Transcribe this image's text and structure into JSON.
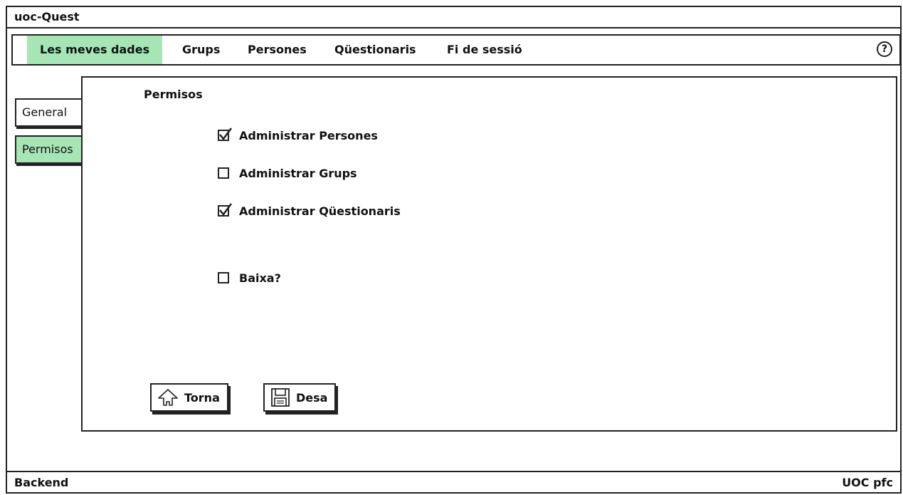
{
  "app": {
    "title": "uoc-Quest"
  },
  "menu": {
    "items": [
      {
        "label": "Les meves dades",
        "active": true
      },
      {
        "label": "Grups",
        "active": false
      },
      {
        "label": "Persones",
        "active": false
      },
      {
        "label": "Qüestionaris",
        "active": false
      },
      {
        "label": "Fi de sessió",
        "active": false
      }
    ],
    "help_symbol": "?"
  },
  "side_tabs": [
    {
      "label": "General",
      "active": false
    },
    {
      "label": "Permisos",
      "active": true
    }
  ],
  "panel": {
    "title": "Permisos",
    "checkboxes": [
      {
        "label": "Administrar Persones",
        "checked": true
      },
      {
        "label": "Administrar Grups",
        "checked": false
      },
      {
        "label": "Administrar Qüestionaris",
        "checked": true
      },
      {
        "label": "Baixa?",
        "checked": false
      }
    ],
    "buttons": {
      "back_label": "Torna",
      "save_label": "Desa"
    }
  },
  "footer": {
    "left": "Backend",
    "right": "UOC pfc"
  },
  "colors": {
    "active_highlight": "#a6e6b6",
    "border": "#222222"
  },
  "icons": {
    "back": "home-arrow-icon",
    "save": "floppy-disk-icon",
    "help": "help-icon"
  }
}
